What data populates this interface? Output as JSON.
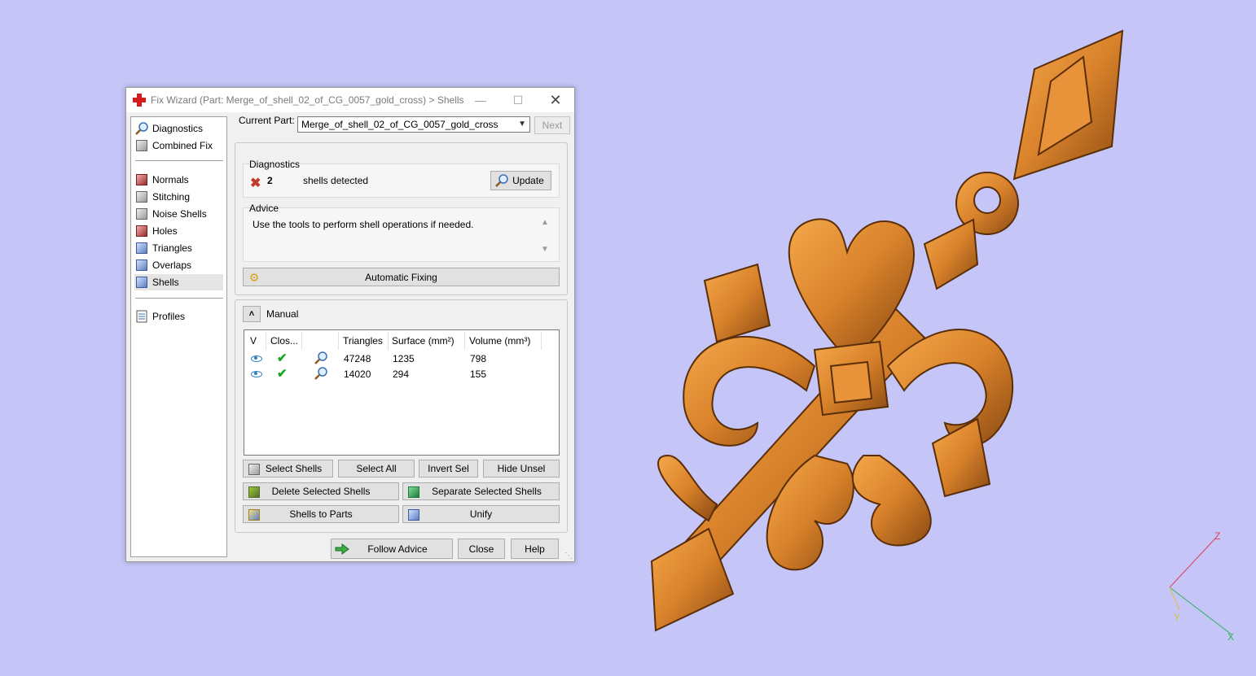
{
  "window": {
    "title": "Fix Wizard (Part: Merge_of_shell_02_of_CG_0057_gold_cross) > Shells",
    "min_glyph": "—",
    "max_glyph": "☐",
    "close_glyph": "✕"
  },
  "sidebar": {
    "items": [
      {
        "label": "Diagnostics",
        "icon": "magnifier-icon"
      },
      {
        "label": "Combined Fix",
        "icon": "cube-icon"
      },
      {
        "label": "Normals",
        "icon": "normals-cube-icon"
      },
      {
        "label": "Stitching",
        "icon": "stitching-cube-icon"
      },
      {
        "label": "Noise Shells",
        "icon": "noise-shells-icon"
      },
      {
        "label": "Holes",
        "icon": "holes-cube-icon"
      },
      {
        "label": "Triangles",
        "icon": "triangles-cube-icon"
      },
      {
        "label": "Overlaps",
        "icon": "overlaps-cube-icon"
      },
      {
        "label": "Shells",
        "icon": "shells-cube-icon",
        "selected": true
      },
      {
        "label": "Profiles",
        "icon": "document-icon"
      }
    ]
  },
  "part": {
    "label": "Current Part:",
    "value": "Merge_of_shell_02_of_CG_0057_gold_cross",
    "next_label": "Next"
  },
  "diagnostics": {
    "group_label": "Diagnostics",
    "count": "2",
    "status_text": "shells detected",
    "update_label": "Update",
    "advice_label": "Advice",
    "advice_text": "Use the tools to perform shell operations if needed.",
    "auto_fix_label": "Automatic Fixing"
  },
  "manual": {
    "label": "Manual",
    "columns": [
      "V",
      "Clos...",
      "",
      "Triangles",
      "Surface (mm²)",
      "Volume (mm³)"
    ],
    "rows": [
      {
        "triangles": "47248",
        "surface": "1235",
        "volume": "798"
      },
      {
        "triangles": "14020",
        "surface": "294",
        "volume": "155"
      }
    ],
    "buttons": {
      "select_shells": "Select Shells",
      "select_all": "Select All",
      "invert_sel": "Invert Sel",
      "hide_unsel": "Hide Unsel",
      "delete_selected": "Delete Selected Shells",
      "separate_selected": "Separate Selected Shells",
      "shells_to_parts": "Shells to Parts",
      "unify": "Unify"
    }
  },
  "footer": {
    "follow_advice": "Follow Advice",
    "close": "Close",
    "help": "Help"
  },
  "viewport": {
    "axis_z": "Z",
    "axis_x": "X",
    "axis_y": "Y",
    "model_color": "#d9822b"
  }
}
